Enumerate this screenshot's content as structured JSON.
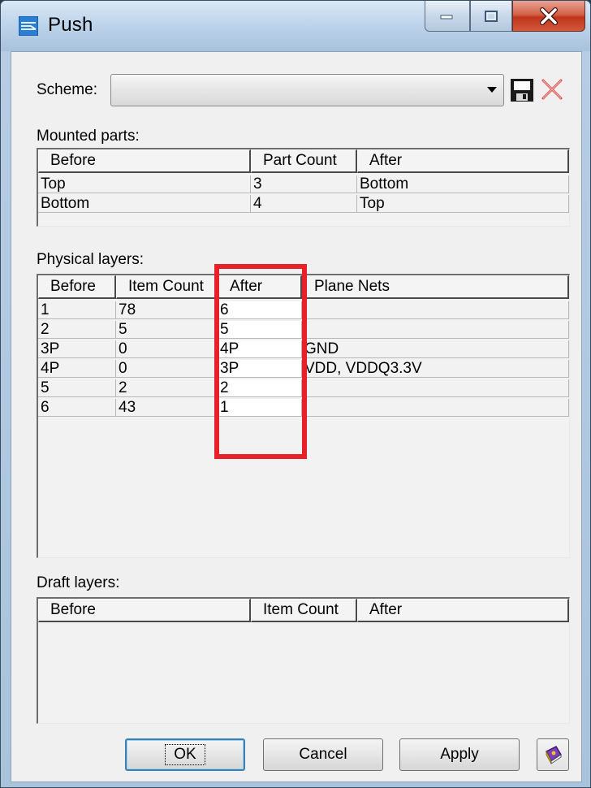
{
  "window": {
    "title": "Push"
  },
  "scheme": {
    "label": "Scheme:",
    "value": ""
  },
  "mounted": {
    "label": "Mounted parts:",
    "headers": [
      "Before",
      "Part Count",
      "After"
    ],
    "rows": [
      [
        "Top",
        "3",
        "Bottom"
      ],
      [
        "Bottom",
        "4",
        "Top"
      ]
    ]
  },
  "physical": {
    "label": "Physical layers:",
    "headers": [
      "Before",
      "Item Count",
      "After",
      "Plane Nets"
    ],
    "rows": [
      [
        "1",
        "78",
        "6",
        ""
      ],
      [
        "2",
        "5",
        "5",
        ""
      ],
      [
        "3P",
        "0",
        "4P",
        "GND"
      ],
      [
        "4P",
        "0",
        "3P",
        "VDD, VDDQ3.3V"
      ],
      [
        "5",
        "2",
        "2",
        ""
      ],
      [
        "6",
        "43",
        "1",
        ""
      ]
    ]
  },
  "draft": {
    "label": "Draft layers:",
    "headers": [
      "Before",
      "Item Count",
      "After"
    ]
  },
  "buttons": {
    "ok": "OK",
    "cancel": "Cancel",
    "apply": "Apply"
  },
  "colors": {
    "highlight": "#e8202a",
    "close": "#c0351c"
  },
  "icons": [
    "app-icon",
    "minimize-icon",
    "maximize-icon",
    "close-icon",
    "save-icon",
    "delete-icon",
    "help-book-icon"
  ]
}
